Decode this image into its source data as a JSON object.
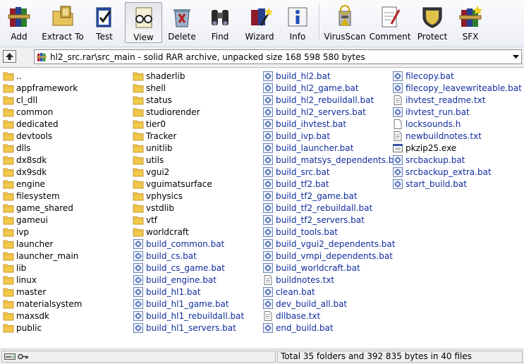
{
  "toolbar": {
    "buttons": [
      {
        "label": "Add",
        "icon": "rar-books-icon"
      },
      {
        "label": "Extract To",
        "icon": "extract-folder-icon"
      },
      {
        "label": "Test",
        "icon": "test-clipboard-icon"
      },
      {
        "label": "View",
        "icon": "view-glasses-icon"
      },
      {
        "label": "Delete",
        "icon": "delete-recycle-icon"
      },
      {
        "label": "Find",
        "icon": "binoculars-icon"
      },
      {
        "label": "Wizard",
        "icon": "wizard-wand-icon"
      },
      {
        "label": "Info",
        "icon": "info-icon"
      },
      {
        "label": "VirusScan",
        "icon": "virus-scan-icon"
      },
      {
        "label": "Comment",
        "icon": "comment-pen-icon"
      },
      {
        "label": "Protect",
        "icon": "shield-icon"
      },
      {
        "label": "SFX",
        "icon": "sfx-books-icon"
      }
    ]
  },
  "address": {
    "path": "hl2_src.rar\\src_main - solid RAR archive, unpacked size 168 598 580 bytes"
  },
  "files": {
    "col1": [
      {
        "name": "..",
        "kind": "folder"
      },
      {
        "name": "appframework",
        "kind": "folder"
      },
      {
        "name": "cl_dll",
        "kind": "folder"
      },
      {
        "name": "common",
        "kind": "folder"
      },
      {
        "name": "dedicated",
        "kind": "folder"
      },
      {
        "name": "devtools",
        "kind": "folder"
      },
      {
        "name": "dlls",
        "kind": "folder"
      },
      {
        "name": "dx8sdk",
        "kind": "folder"
      },
      {
        "name": "dx9sdk",
        "kind": "folder"
      },
      {
        "name": "engine",
        "kind": "folder"
      },
      {
        "name": "filesystem",
        "kind": "folder"
      },
      {
        "name": "game_shared",
        "kind": "folder"
      },
      {
        "name": "gameui",
        "kind": "folder"
      },
      {
        "name": "ivp",
        "kind": "folder"
      },
      {
        "name": "launcher",
        "kind": "folder"
      },
      {
        "name": "launcher_main",
        "kind": "folder"
      },
      {
        "name": "lib",
        "kind": "folder"
      },
      {
        "name": "linux",
        "kind": "folder"
      },
      {
        "name": "master",
        "kind": "folder"
      },
      {
        "name": "materialsystem",
        "kind": "folder"
      },
      {
        "name": "maxsdk",
        "kind": "folder"
      },
      {
        "name": "public",
        "kind": "folder"
      }
    ],
    "col2": [
      {
        "name": "shaderlib",
        "kind": "folder"
      },
      {
        "name": "shell",
        "kind": "folder"
      },
      {
        "name": "status",
        "kind": "folder"
      },
      {
        "name": "studiorender",
        "kind": "folder"
      },
      {
        "name": "tier0",
        "kind": "folder"
      },
      {
        "name": "Tracker",
        "kind": "folder"
      },
      {
        "name": "unitlib",
        "kind": "folder"
      },
      {
        "name": "utils",
        "kind": "folder"
      },
      {
        "name": "vgui2",
        "kind": "folder"
      },
      {
        "name": "vguimatsurface",
        "kind": "folder"
      },
      {
        "name": "vphysics",
        "kind": "folder"
      },
      {
        "name": "vstdlib",
        "kind": "folder"
      },
      {
        "name": "vtf",
        "kind": "folder"
      },
      {
        "name": "worldcraft",
        "kind": "folder"
      },
      {
        "name": "build_common.bat",
        "kind": "bat"
      },
      {
        "name": "build_cs.bat",
        "kind": "bat"
      },
      {
        "name": "build_cs_game.bat",
        "kind": "bat"
      },
      {
        "name": "build_engine.bat",
        "kind": "bat"
      },
      {
        "name": "build_hl1.bat",
        "kind": "bat"
      },
      {
        "name": "build_hl1_game.bat",
        "kind": "bat"
      },
      {
        "name": "build_hl1_rebuildall.bat",
        "kind": "bat"
      },
      {
        "name": "build_hl1_servers.bat",
        "kind": "bat"
      }
    ],
    "col3": [
      {
        "name": "build_hl2.bat",
        "kind": "bat"
      },
      {
        "name": "build_hl2_game.bat",
        "kind": "bat"
      },
      {
        "name": "build_hl2_rebuildall.bat",
        "kind": "bat"
      },
      {
        "name": "build_hl2_servers.bat",
        "kind": "bat"
      },
      {
        "name": "build_ihvtest.bat",
        "kind": "bat"
      },
      {
        "name": "build_ivp.bat",
        "kind": "bat"
      },
      {
        "name": "build_launcher.bat",
        "kind": "bat"
      },
      {
        "name": "build_matsys_dependents.bat",
        "kind": "bat"
      },
      {
        "name": "build_src.bat",
        "kind": "bat"
      },
      {
        "name": "build_tf2.bat",
        "kind": "bat"
      },
      {
        "name": "build_tf2_game.bat",
        "kind": "bat"
      },
      {
        "name": "build_tf2_rebuildall.bat",
        "kind": "bat"
      },
      {
        "name": "build_tf2_servers.bat",
        "kind": "bat"
      },
      {
        "name": "build_tools.bat",
        "kind": "bat"
      },
      {
        "name": "build_vgui2_dependents.bat",
        "kind": "bat"
      },
      {
        "name": "build_vmpi_dependents.bat",
        "kind": "bat"
      },
      {
        "name": "build_worldcraft.bat",
        "kind": "bat"
      },
      {
        "name": "buildnotes.txt",
        "kind": "txt"
      },
      {
        "name": "clean.bat",
        "kind": "bat"
      },
      {
        "name": "dev_build_all.bat",
        "kind": "bat"
      },
      {
        "name": "dllbase.txt",
        "kind": "txt"
      },
      {
        "name": "end_build.bat",
        "kind": "bat"
      }
    ],
    "col4": [
      {
        "name": "filecopy.bat",
        "kind": "bat"
      },
      {
        "name": "filecopy_leavewriteable.bat",
        "kind": "bat"
      },
      {
        "name": "ihvtest_readme.txt",
        "kind": "txt"
      },
      {
        "name": "ihvtest_run.bat",
        "kind": "bat"
      },
      {
        "name": "locksounds.h",
        "kind": "h"
      },
      {
        "name": "newbuildnotes.txt",
        "kind": "txt"
      },
      {
        "name": "pkzip25.exe",
        "kind": "exe"
      },
      {
        "name": "srcbackup.bat",
        "kind": "bat"
      },
      {
        "name": "srcbackup_extra.bat",
        "kind": "bat"
      },
      {
        "name": "start_build.bat",
        "kind": "bat"
      }
    ]
  },
  "status": {
    "summary": "Total 35 folders and 392 835 bytes in 40 files"
  },
  "colors": {
    "folder": "#f2c94c",
    "bat_text": "#0f2e9e",
    "toolbar_bg": "#eceef5"
  }
}
